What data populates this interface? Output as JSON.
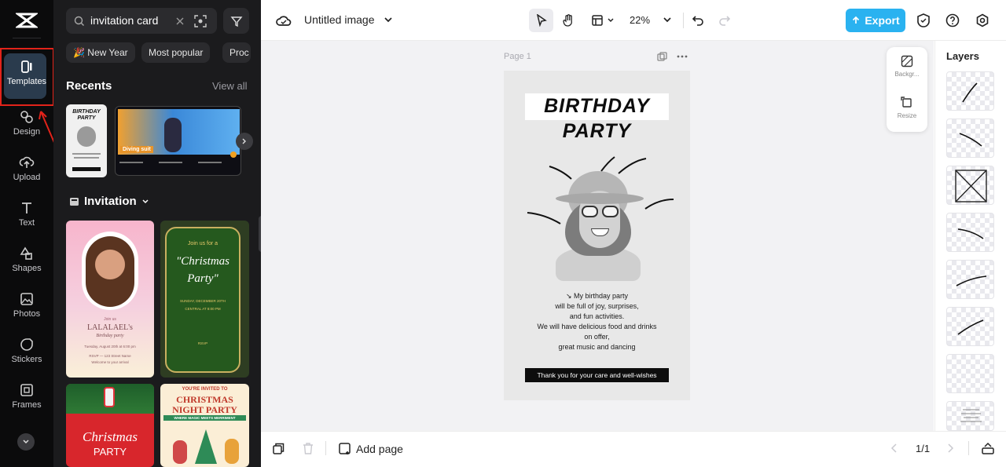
{
  "rail": {
    "items": [
      {
        "label": "Templates",
        "icon": "templates-icon"
      },
      {
        "label": "Design",
        "icon": "design-icon"
      },
      {
        "label": "Upload",
        "icon": "upload-icon"
      },
      {
        "label": "Text",
        "icon": "text-icon"
      },
      {
        "label": "Shapes",
        "icon": "shapes-icon"
      },
      {
        "label": "Photos",
        "icon": "photos-icon"
      },
      {
        "label": "Stickers",
        "icon": "stickers-icon"
      },
      {
        "label": "Frames",
        "icon": "frames-icon"
      }
    ]
  },
  "panel": {
    "search_value": "invitation card",
    "chips": [
      "🎉 New Year",
      "Most popular",
      "Proc"
    ],
    "recents_title": "Recents",
    "view_all": "View all",
    "recent1": {
      "title_line1": "BIRTHDAY",
      "title_line2": "PARTY"
    },
    "recent2": {
      "badge": "Diving suit"
    },
    "invitation_label": "Invitation",
    "template1": {
      "name": "LALALAEL's",
      "subtitle": "Birthday party",
      "join": "Join us",
      "date": "Tuesday, August 20th at 6:00 pm",
      "address": "RSVP — 123 Street Name",
      "welcome": "Welcome to your arrival"
    },
    "template2": {
      "top": "Join us for a",
      "title1": "\"Christmas",
      "title2": "Party\"",
      "details": "SUNDAY, DECEMBER 20TH",
      "line2": "CENTRAL AT 8:00 PM",
      "rsvp": "RSVP"
    },
    "template3": {
      "title1": "Christmas",
      "title2": "PARTY"
    },
    "template4": {
      "top": "YOU'RE INVITED TO",
      "title1": "CHRISTMAS",
      "title2": "NIGHT PARTY",
      "sub": "WHERE MAGIC MEETS MERRIMENT"
    }
  },
  "topbar": {
    "doc_title": "Untitled image",
    "zoom": "22%",
    "export_label": "Export"
  },
  "canvas": {
    "page_label": "Page 1",
    "heading1": "BIRTHDAY",
    "heading2": "PARTY",
    "body_lines": [
      "↘ My birthday party",
      "will be full of joy, surprises,",
      "and fun activities.",
      "We will have delicious food and drinks",
      "on offer,",
      "great music and dancing"
    ],
    "footer": "Thank you for your care and well-wishes"
  },
  "side_tools": {
    "background": "Backgr...",
    "resize": "Resize"
  },
  "layers": {
    "title": "Layers",
    "count": 8
  },
  "bottombar": {
    "add_page": "Add page",
    "page_count": "1/1"
  },
  "colors": {
    "export": "#2ab2f0",
    "rail": "#0b0b0c",
    "panel": "#1b1b1d",
    "highlight": "#e2231a",
    "canvas_page": "#e8e8e8"
  }
}
